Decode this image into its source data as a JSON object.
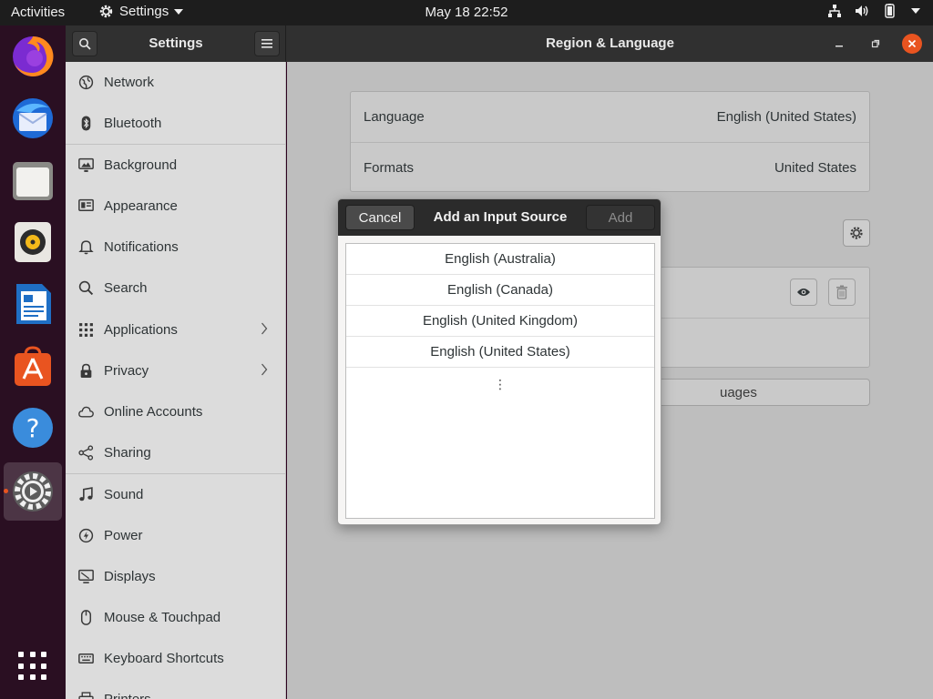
{
  "topbar": {
    "activities": "Activities",
    "app_menu": "Settings",
    "clock": "May 18  22:52",
    "tray_icons": [
      "network-icon",
      "volume-icon",
      "battery-icon",
      "system-menu-chevron-icon"
    ]
  },
  "dock": {
    "items": [
      {
        "name": "Firefox",
        "icon": "firefox-icon"
      },
      {
        "name": "Thunderbird Mail",
        "icon": "thunderbird-icon"
      },
      {
        "name": "Files",
        "icon": "files-icon"
      },
      {
        "name": "Rhythmbox",
        "icon": "rhythmbox-icon"
      },
      {
        "name": "LibreOffice Writer",
        "icon": "writer-icon"
      },
      {
        "name": "Ubuntu Software",
        "icon": "software-icon"
      },
      {
        "name": "Help",
        "icon": "help-icon"
      },
      {
        "name": "Settings",
        "icon": "settings-icon",
        "active": true
      }
    ],
    "show_apps_icon": "show-applications-icon"
  },
  "header": {
    "sidebar_title": "Settings",
    "main_title": "Region & Language"
  },
  "sidebar": {
    "items": [
      {
        "label": "Network",
        "icon": "network-globe-icon"
      },
      {
        "label": "Bluetooth",
        "icon": "bluetooth-icon"
      },
      {
        "label": "Background",
        "icon": "background-icon"
      },
      {
        "label": "Appearance",
        "icon": "appearance-icon"
      },
      {
        "label": "Notifications",
        "icon": "bell-icon"
      },
      {
        "label": "Search",
        "icon": "search-icon"
      },
      {
        "label": "Applications",
        "icon": "apps-grid-icon",
        "chevron": true
      },
      {
        "label": "Privacy",
        "icon": "lock-icon",
        "chevron": true
      },
      {
        "label": "Online Accounts",
        "icon": "cloud-icon"
      },
      {
        "label": "Sharing",
        "icon": "share-icon"
      },
      {
        "label": "Sound",
        "icon": "music-note-icon"
      },
      {
        "label": "Power",
        "icon": "power-icon"
      },
      {
        "label": "Displays",
        "icon": "display-icon"
      },
      {
        "label": "Mouse & Touchpad",
        "icon": "mouse-icon"
      },
      {
        "label": "Keyboard Shortcuts",
        "icon": "keyboard-icon"
      },
      {
        "label": "Printers",
        "icon": "printer-icon"
      }
    ]
  },
  "region": {
    "language_label": "Language",
    "language_value": "English (United States)",
    "formats_label": "Formats",
    "formats_value": "United States",
    "manage_languages_partial": "uages"
  },
  "dialog": {
    "cancel": "Cancel",
    "title": "Add an Input Source",
    "add": "Add",
    "options": [
      "English (Australia)",
      "English (Canada)",
      "English (United Kingdom)",
      "English (United States)"
    ],
    "more_symbol": "⋮"
  },
  "colors": {
    "accent": "#e95420",
    "topbar": "#1d1d1d",
    "dock": "#2a0f22",
    "headerbar": "#303030"
  }
}
